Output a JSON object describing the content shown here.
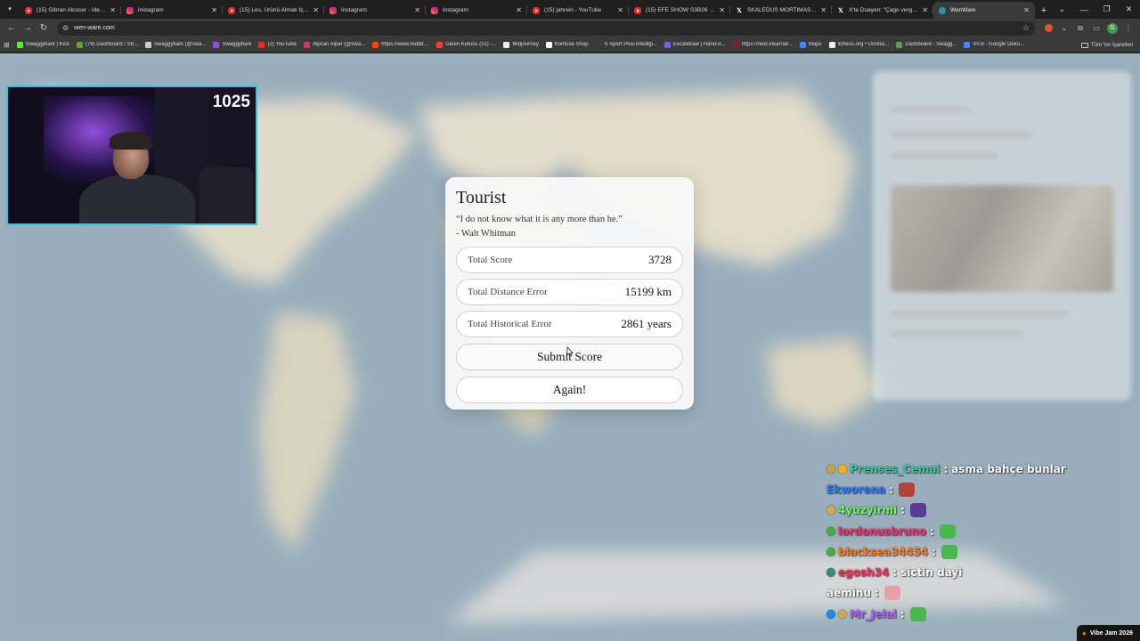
{
  "browser": {
    "tabs": [
      {
        "title": "(15) Gibran Alcocer - Idea 10",
        "icon": "youtube-icon",
        "active": false
      },
      {
        "title": "instagram",
        "icon": "instagram-icon",
        "active": false
      },
      {
        "title": "(15) Les, Ürünü Almak İçin Mi",
        "icon": "youtube-icon",
        "active": false
      },
      {
        "title": "Instagram",
        "icon": "instagram-icon",
        "active": false
      },
      {
        "title": "Instagram",
        "icon": "instagram-icon",
        "active": false
      },
      {
        "title": "(15) jahrein - YouTube",
        "icon": "youtube-icon",
        "active": false
      },
      {
        "title": "(15) EFE SHOW S3B26 | MÖSY",
        "icon": "youtube-icon",
        "active": false
      },
      {
        "title": "SKALEDUS MORTIMAS Toplu",
        "icon": "x-icon",
        "active": false
      },
      {
        "title": "X'te Duayen: \"Çago vergi mü",
        "icon": "x-icon",
        "active": false
      },
      {
        "title": "WenWare",
        "icon": "wenware-icon",
        "active": true
      }
    ],
    "url": "wen-ware.com",
    "bookmarks": [
      {
        "label": "Swaggybark | Kick",
        "color": "#53fc18"
      },
      {
        "label": "(79) Dashboard / Str...",
        "color": "#6b9f3a"
      },
      {
        "label": "Swaggybark (@swa...",
        "color": "#cccccc"
      },
      {
        "label": "Swaggybark",
        "color": "#9146ff"
      },
      {
        "label": "(2) YouTube",
        "color": "#e52d27"
      },
      {
        "label": "Alpcan Alpar (@swa...",
        "color": "#e1306c"
      },
      {
        "label": "https://www.reddit....",
        "color": "#ff4500"
      },
      {
        "label": "Gelen Kutusu (31) -...",
        "color": "#ea4335"
      },
      {
        "label": "Midjourney",
        "color": "#eeeeee"
      },
      {
        "label": "Konfuse Shop",
        "color": "#ffffff"
      },
      {
        "label": "S Sport Plus-İstediği...",
        "color": "#3a3a3a"
      },
      {
        "label": "Excalidraw | Hand-d...",
        "color": "#6965db"
      },
      {
        "label": "https://next.inkarnat...",
        "color": "#8b1e1e"
      },
      {
        "label": "Maps",
        "color": "#4285f4"
      },
      {
        "label": "lichess.org • Ücretsi...",
        "color": "#eeeeee"
      },
      {
        "label": "Dashboard - Swagg...",
        "color": "#53a046"
      },
      {
        "label": "V0.8 - Google Dokü...",
        "color": "#4285f4"
      }
    ],
    "bookmarks_folder": "Tüm Yer İşaretleri"
  },
  "webcam": {
    "score": "1025"
  },
  "modal": {
    "title": "Tourist",
    "quote": "“I do not know what it is any more than he.”",
    "author": "- Walt Whitman",
    "stats": [
      {
        "label": "Total Score",
        "value": "3728"
      },
      {
        "label": "Total Distance Error",
        "value": "15199 km"
      },
      {
        "label": "Total Historical Error",
        "value": "2861 years"
      }
    ],
    "submit_label": "Submit Score",
    "again_label": "Again!"
  },
  "chat": [
    {
      "user": "Prenses_Cemal",
      "color": "#2fcf9a",
      "badges": [
        "#c8a24a",
        "#f2b01e"
      ],
      "message": "asma bahçe bunlar",
      "emote": null
    },
    {
      "user": "Ekworena",
      "color": "#2b7cff",
      "badges": [],
      "message": "",
      "emote": "#b3433a"
    },
    {
      "user": "4yuzyirmi",
      "color": "#6cff5a",
      "badges": [
        "#d0a85a"
      ],
      "message": "",
      "emote": "#5a3a9a"
    },
    {
      "user": "lordanusbruno",
      "color": "#ff2a6d",
      "badges": [
        "#4aa84a"
      ],
      "message": "",
      "emote": "#46b84e"
    },
    {
      "user": "blacksea34454",
      "color": "#ff7a1a",
      "badges": [
        "#4aa84a"
      ],
      "message": "",
      "emote": "#46b84e"
    },
    {
      "user": "egosh34",
      "color": "#ff2a55",
      "badges": [
        "#3a8a7a"
      ],
      "message": "sictin dayi",
      "emote": null
    },
    {
      "user": "aeminu",
      "color": "#ffffff",
      "badges": [],
      "message": "",
      "emote": "#e8a0a6"
    },
    {
      "user": "Mr_Jelal",
      "color": "#b05cff",
      "badges": [
        "#1e88e5",
        "#d0a85a"
      ],
      "message": "",
      "emote": "#46b84e"
    }
  ],
  "overlay_badge": "Vibe Jam 2026"
}
